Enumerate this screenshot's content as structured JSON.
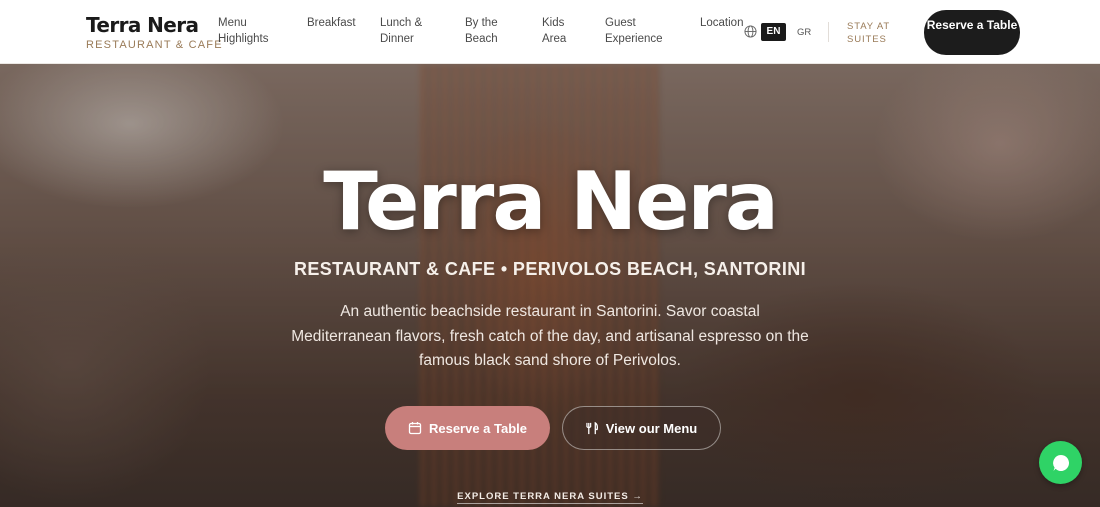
{
  "brand": {
    "name": "Terra Nera",
    "subtitle": "RESTAURANT & CAFE"
  },
  "nav": {
    "items": [
      {
        "label": "Menu Highlights"
      },
      {
        "label": "Breakfast"
      },
      {
        "label": "Lunch & Dinner"
      },
      {
        "label": "By the Beach"
      },
      {
        "label": "Kids Area"
      },
      {
        "label": "Guest Experience"
      },
      {
        "label": "Location"
      }
    ],
    "lang_active": "EN",
    "lang_other": "GR",
    "stay_label": "STAY AT SUITES",
    "reserve_label": "Reserve a Table"
  },
  "hero": {
    "title": "Terra Nera",
    "subtitle": "RESTAURANT & CAFE • PERIVOLOS BEACH, SANTORINI",
    "description": "An authentic beachside restaurant in Santorini. Savor coastal Mediterranean flavors, fresh catch of the day, and artisanal espresso on the famous black sand shore of Perivolos.",
    "cta_reserve": "Reserve a Table",
    "cta_menu": "View our Menu",
    "explore_link": "EXPLORE TERRA NERA SUITES →"
  },
  "icons": {
    "globe": "globe-icon",
    "calendar": "calendar-icon",
    "utensils": "utensils-icon",
    "chat": "whatsapp-chat-icon"
  },
  "colors": {
    "accent_rose": "#c87f7c",
    "brand_gold": "#9a7b58",
    "dark": "#1c1c1c",
    "chat_green": "#2fd366"
  }
}
